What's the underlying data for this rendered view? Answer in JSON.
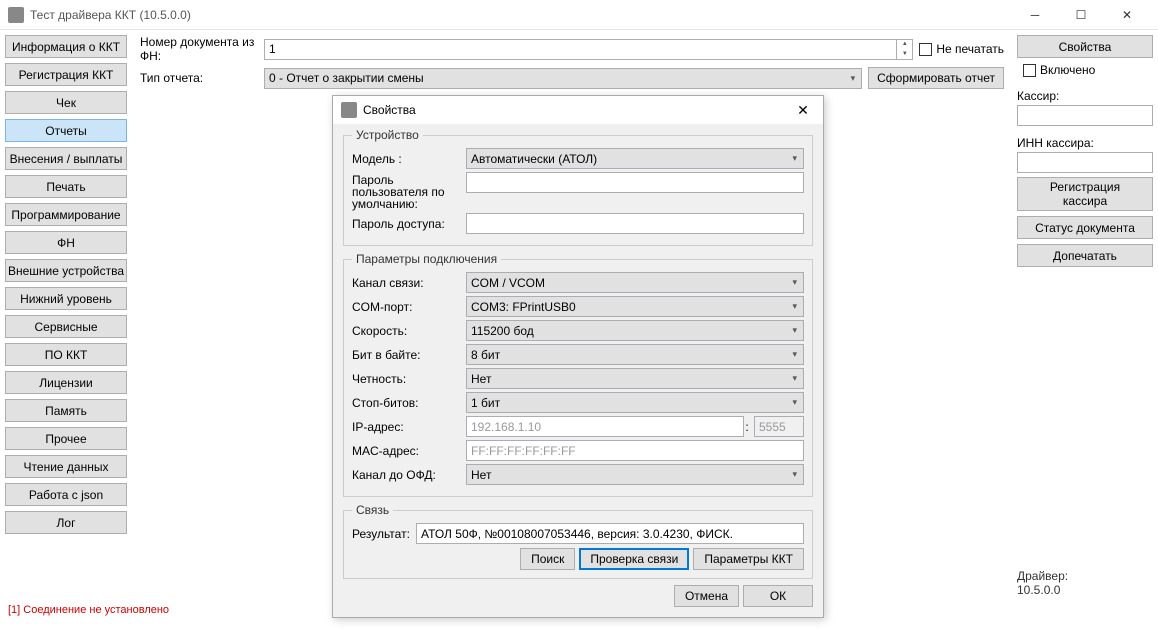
{
  "window": {
    "title": "Тест драйвера ККТ (10.5.0.0)"
  },
  "nav": [
    "Информация о ККТ",
    "Регистрация ККТ",
    "Чек",
    "Отчеты",
    "Внесения / выплаты",
    "Печать",
    "Программирование",
    "ФН",
    "Внешние устройства",
    "Нижний уровень",
    "Сервисные",
    "ПО ККТ",
    "Лицензии",
    "Память",
    "Прочее",
    "Чтение данных",
    "Работа с json",
    "Лог"
  ],
  "nav_active": 3,
  "center": {
    "doc_label": "Номер документа из ФН:",
    "doc_value": "1",
    "noprint": "Не печатать",
    "type_label": "Тип отчета:",
    "type_value": "0 - Отчет о закрытии смены",
    "gen": "Сформировать отчет"
  },
  "right": {
    "props": "Свойства",
    "enabled": "Включено",
    "cashier": "Кассир:",
    "inn": "ИНН кассира:",
    "reg": "Регистрация\nкассира",
    "docstatus": "Статус документа",
    "reprint": "Допечатать",
    "driver_label": "Драйвер:",
    "driver_ver": "10.5.0.0"
  },
  "dialog": {
    "title": "Свойства",
    "grp_device": "Устройство",
    "model_l": "Модель :",
    "model_v": "Автоматически (АТОЛ)",
    "upass_l": "Пароль пользователя по умолчанию:",
    "apass_l": "Пароль доступа:",
    "grp_conn": "Параметры подключения",
    "chan_l": "Канал связи:",
    "chan_v": "COM / VCOM",
    "com_l": "COM-порт:",
    "com_v": "COM3: FPrintUSB0",
    "baud_l": "Скорость:",
    "baud_v": "115200 бод",
    "bits_l": "Бит в байте:",
    "bits_v": "8 бит",
    "parity_l": "Четность:",
    "parity_v": "Нет",
    "stop_l": "Стоп-битов:",
    "stop_v": "1 бит",
    "ip_l": "IP-адрес:",
    "ip_v": "192.168.1.10",
    "port_v": "5555",
    "mac_l": "MAC-адрес:",
    "mac_v": "FF:FF:FF:FF:FF:FF",
    "ofd_l": "Канал до ОФД:",
    "ofd_v": "Нет",
    "grp_link": "Связь",
    "result_l": "Результат:",
    "result_v": "АТОЛ 50Ф, №00108007053446, версия: 3.0.4230, ФИСК.",
    "search": "Поиск",
    "test": "Проверка связи",
    "kktparams": "Параметры ККТ",
    "cancel": "Отмена",
    "ok": "ОК"
  },
  "status": "[1] Соединение не установлено"
}
